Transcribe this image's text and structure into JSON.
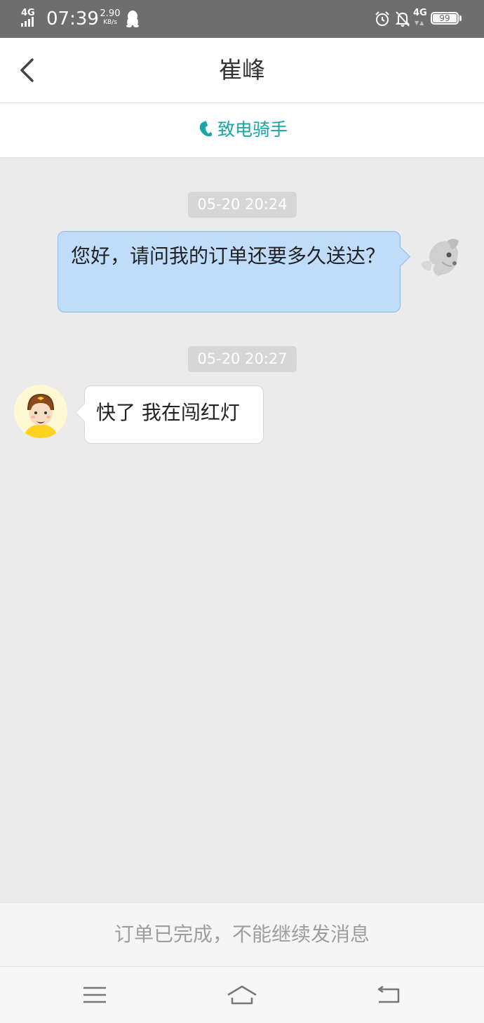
{
  "status_bar": {
    "network": "4G",
    "time": "07:39",
    "speed_value": "2.90",
    "speed_unit": "KB/s",
    "network_right": "4G",
    "network_arrows": "▼▲",
    "battery": "99",
    "icons": [
      "signal-icon",
      "qq-icon",
      "alarm-icon",
      "mute-icon",
      "battery-icon"
    ]
  },
  "header": {
    "title": "崔峰",
    "back_icon": "chevron-left-icon"
  },
  "call": {
    "label": "致电骑手",
    "icon": "phone-icon",
    "color": "#1ba6a6"
  },
  "messages": [
    {
      "timestamp": "05-20 20:24",
      "sender": "me",
      "text": "您好，请问我的订单还要多久送达？",
      "bubble_color": "#c0dcfb"
    },
    {
      "timestamp": "05-20 20:27",
      "sender": "rider",
      "text": "快了 我在闯红灯",
      "bubble_color": "#ffffff"
    }
  ],
  "footer": {
    "notice": "订单已完成，不能继续发消息"
  },
  "nav": {
    "icons": [
      "menu-icon",
      "home-icon",
      "back-icon"
    ]
  }
}
